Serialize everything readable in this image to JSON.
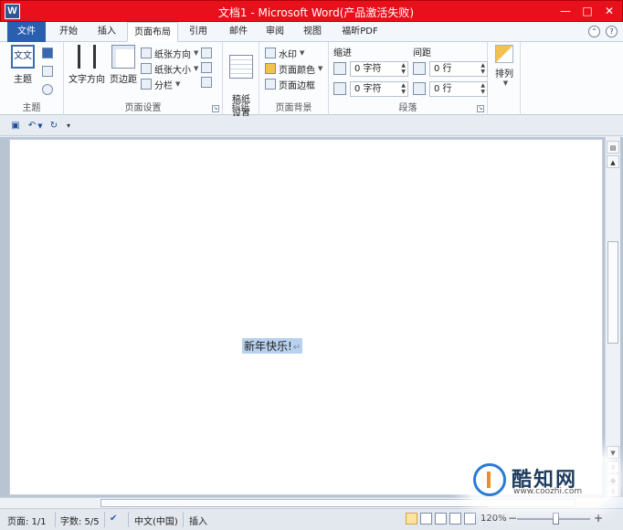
{
  "title_bar": {
    "title": "文档1 - Microsoft Word(产品激活失败)",
    "app_icon": "W",
    "buttons": [
      "—",
      "□",
      "✕"
    ]
  },
  "tabs": [
    {
      "label": "文件"
    },
    {
      "label": "开始"
    },
    {
      "label": "插入"
    },
    {
      "label": "页面布局"
    },
    {
      "label": "引用"
    },
    {
      "label": "邮件"
    },
    {
      "label": "审阅"
    },
    {
      "label": "视图"
    },
    {
      "label": "福昕PDF"
    }
  ],
  "ribbon": {
    "themes": {
      "theme_label": "主题",
      "theme_icon_text": "文文",
      "group_label": "主题"
    },
    "page_setup": {
      "text_direction": "文字方向",
      "margins": "页边距",
      "orientation": "纸张方向",
      "size": "纸张大小",
      "columns": "分栏",
      "group_label": "页面设置"
    },
    "draft": {
      "button": "稿纸\n设置",
      "group_label": "稿纸"
    },
    "page_background": {
      "watermark": "水印",
      "page_color": "页面颜色",
      "page_borders": "页面边框",
      "group_label": "页面背景"
    },
    "paragraph": {
      "indent_label": "缩进",
      "spacing_label": "间距",
      "indent_left": "0 字符",
      "indent_right": "0 字符",
      "spacing_before": "0 行",
      "spacing_after": "0 行",
      "group_label": "段落"
    },
    "arrange": {
      "button": "排列"
    }
  },
  "document": {
    "text": "新年快乐!",
    "para_mark": "↵"
  },
  "status_bar": {
    "page": "页面: 1/1",
    "words": "字数: 5/5",
    "language": "中文(中国)",
    "mode": "插入",
    "zoom": "120%"
  },
  "watermark": {
    "name": "酷知网",
    "url": "www.coozhi.com"
  }
}
